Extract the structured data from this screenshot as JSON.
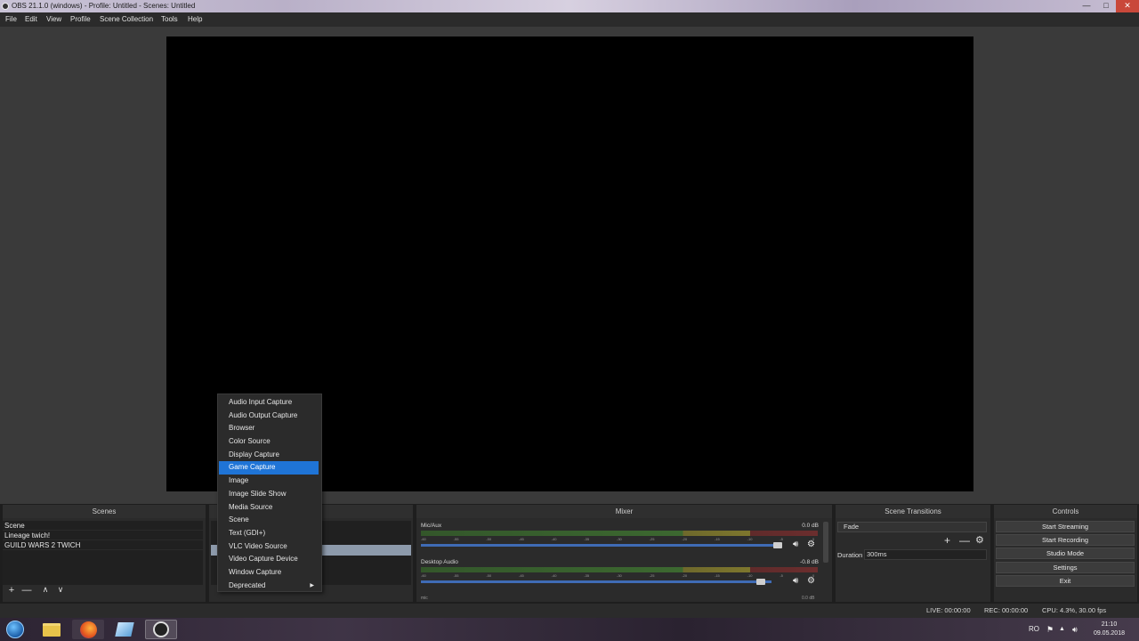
{
  "window": {
    "title": "OBS 21.1.0 (windows) - Profile: Untitled - Scenes: Untitled",
    "minimize": "—",
    "maximize": "□",
    "close": "✕"
  },
  "menu": [
    "File",
    "Edit",
    "View",
    "Profile",
    "Scene Collection",
    "Tools",
    "Help"
  ],
  "docks": {
    "scenes": "Scenes",
    "mixer": "Mixer",
    "transitions": "Scene Transitions",
    "controls": "Controls"
  },
  "scenes": [
    "Scene",
    "Lineage twich!",
    "GUILD WARS 2 TWICH"
  ],
  "scene_toolbar": {
    "add": "+",
    "remove": "—",
    "up": "∧",
    "down": "∨"
  },
  "mixer": {
    "channels": [
      {
        "name": "Mic/Aux",
        "db": "0.0 dB",
        "volume": 1.0
      },
      {
        "name": "Desktop Audio",
        "db": "-0.8 dB",
        "volume": 0.97
      }
    ],
    "ticks": [
      "-60",
      "-55",
      "-50",
      "-45",
      "-40",
      "-35",
      "-30",
      "-25",
      "-20",
      "-15",
      "-10",
      "-5",
      "0"
    ],
    "next_channel": "mic",
    "next_db": "0.0 dB"
  },
  "transitions": {
    "selected": "Fade",
    "duration_label": "Duration",
    "duration_value": "300ms"
  },
  "controls": [
    "Start Streaming",
    "Start Recording",
    "Studio Mode",
    "Settings",
    "Exit"
  ],
  "status": {
    "live": "LIVE: 00:00:00",
    "rec": "REC: 00:00:00",
    "cpu": "CPU: 4.3%, 30.00 fps"
  },
  "context_menu": {
    "items": [
      "Audio Input Capture",
      "Audio Output Capture",
      "Browser",
      "Color Source",
      "Display Capture",
      "Game Capture",
      "Image",
      "Image Slide Show",
      "Media Source",
      "Scene",
      "Text (GDI+)",
      "VLC Video Source",
      "Video Capture Device",
      "Window Capture",
      "Deprecated"
    ],
    "highlighted": "Game Capture"
  },
  "taskbar": {
    "lang": "RO",
    "time": "21:10",
    "date": "09.05.2018"
  },
  "colors": {
    "accent": "#1f74d6",
    "preview": "#000000",
    "panel": "#2b2b2b"
  }
}
